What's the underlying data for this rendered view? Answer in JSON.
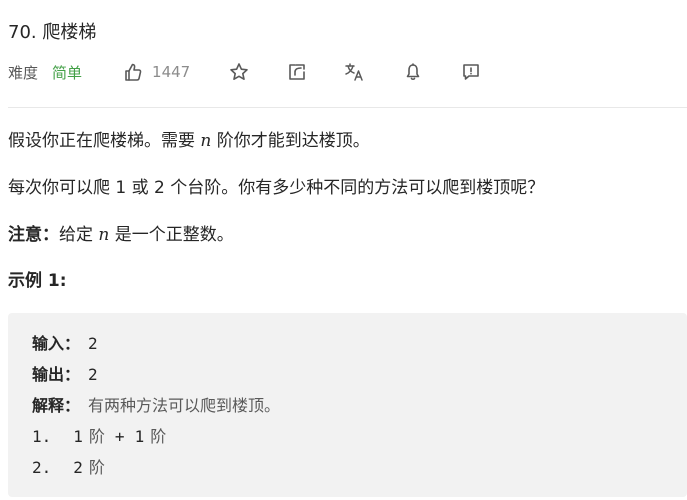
{
  "problem": {
    "title": "70. 爬楼梯",
    "difficulty_label": "难度",
    "difficulty_value": "简单",
    "like_count": "1447",
    "colors": {
      "difficulty_easy": "#43a047",
      "muted": "#8c8c8c"
    },
    "icons": [
      "thumb-up-icon",
      "star-icon",
      "share-icon",
      "translate-icon",
      "bell-icon",
      "feedback-icon"
    ]
  },
  "description": {
    "p1_before": "假设你正在爬楼梯。需要 ",
    "p1_var": "n",
    "p1_after": " 阶你才能到达楼顶。",
    "p2": "每次你可以爬 1 或 2 个台阶。你有多少种不同的方法可以爬到楼顶呢？",
    "note_label": "注意：",
    "note_before": "给定 ",
    "note_var": "n",
    "note_after": " 是一个正整数。"
  },
  "example": {
    "title": "示例 1:",
    "input_label": "输入：",
    "input_value": "2",
    "output_label": "输出：",
    "output_value": "2",
    "explain_label": "解释：",
    "explain_value": "有两种方法可以爬到楼顶。",
    "steps": [
      {
        "num": "1.",
        "a": "1",
        "unit_a": "阶",
        "plus": "+",
        "b": "1",
        "unit_b": "阶"
      },
      {
        "num": "2.",
        "a": "2",
        "unit_a": "阶"
      }
    ]
  }
}
